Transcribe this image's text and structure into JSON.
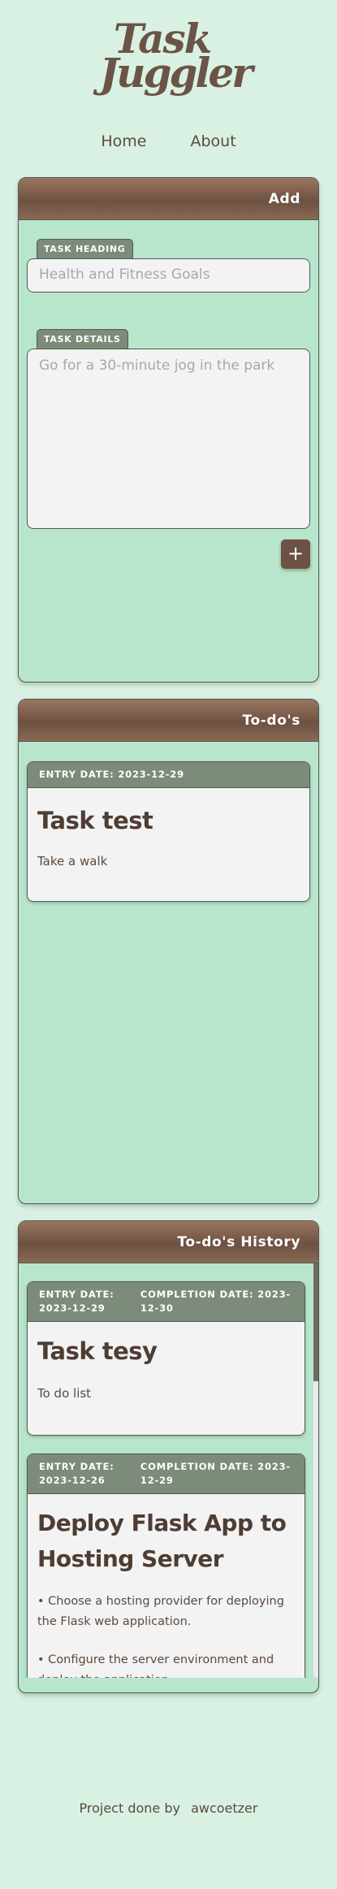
{
  "logo": {
    "line1": "Task",
    "line2": "Juggler"
  },
  "nav": {
    "home": "Home",
    "about": "About"
  },
  "add_card": {
    "title": "Add",
    "heading_tab": "TASK HEADING",
    "heading_placeholder": "Health and Fitness Goals",
    "details_tab": "TASK DETAILS",
    "details_placeholder": "Go for a 30-minute jog in the park",
    "add_button": "+"
  },
  "todos_card": {
    "title": "To-do's",
    "tasks": [
      {
        "entry": "ENTRY DATE: 2023-12-29",
        "title": "Task test",
        "body": "Take a walk"
      }
    ]
  },
  "history_card": {
    "title": "To-do's History",
    "tasks": [
      {
        "entry": "ENTRY DATE: 2023-12-29",
        "completion": "COMPLETION DATE: 2023-12-30",
        "title": "Task tesy",
        "body": [
          "To do list"
        ]
      },
      {
        "entry": "ENTRY DATE: 2023-12-26",
        "completion": "COMPLETION DATE: 2023-12-29",
        "title": "Deploy Flask App to Hosting Server",
        "body": [
          "• Choose a hosting provider for deploying the Flask web application.",
          "• Configure the server environment and deploy the application."
        ]
      }
    ]
  },
  "footer": {
    "text": "Project done by",
    "author": "awcoetzer"
  }
}
